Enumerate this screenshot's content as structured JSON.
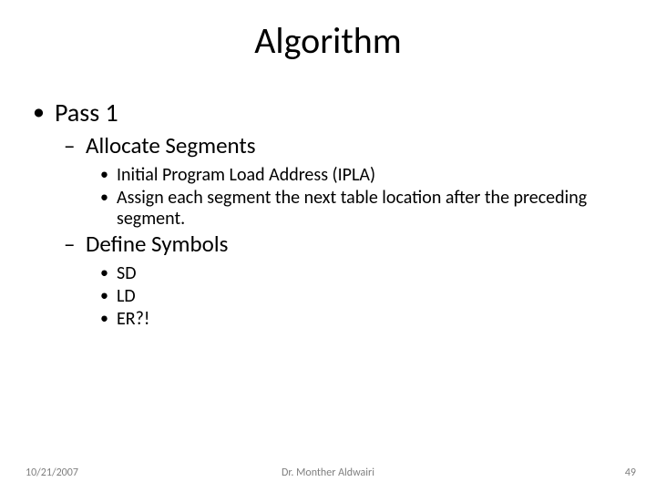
{
  "title": "Algorithm",
  "bullets": {
    "pass1": "Pass 1",
    "allocate": "Allocate Segments",
    "ipla": "Initial Program Load Address (IPLA)",
    "assign": "Assign each segment the next table location after the preceding segment.",
    "define": "Define Symbols",
    "sd": "SD",
    "ld": "LD",
    "er": "ER?!"
  },
  "footer": {
    "date": "10/21/2007",
    "author": "Dr. Monther Aldwairi",
    "page": "49"
  }
}
